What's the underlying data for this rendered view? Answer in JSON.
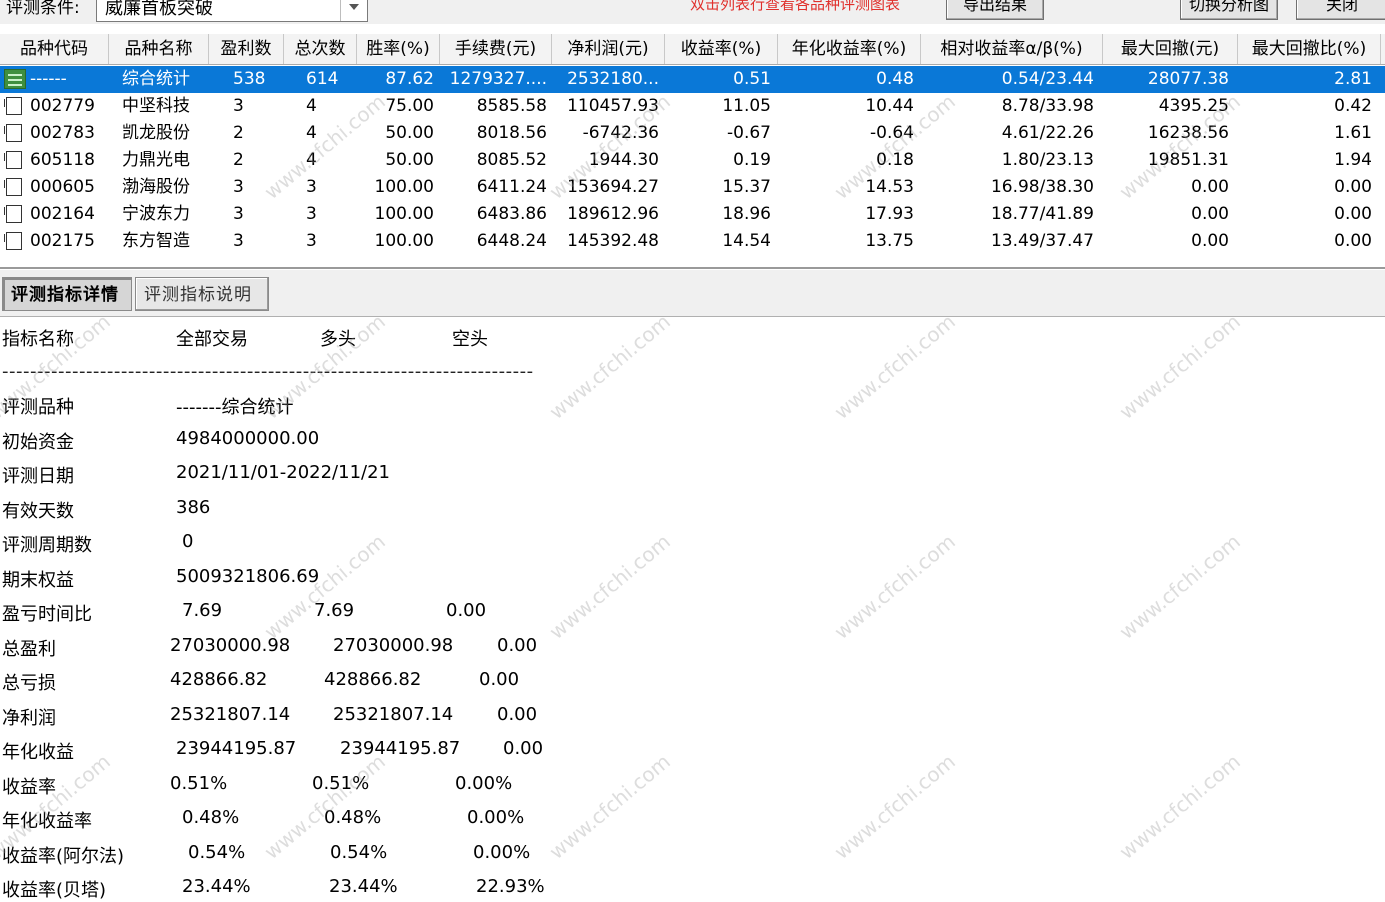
{
  "toolbar": {
    "condition_label": "评测条件:",
    "condition_value": "威廉首板突破",
    "hint": "双击列表行查看各品种评测图表",
    "export_button": "导出结果",
    "switch_button": "切换分析图",
    "close_button": "关闭"
  },
  "table": {
    "headers": [
      "品种代码",
      "品种名称",
      "盈利数",
      "总次数",
      "胜率(%)",
      "手续费(元)",
      "净利润(元)",
      "收益率(%)",
      "年化收益率(%)",
      "相对收益率α/β(%)",
      "最大回撤(元)",
      "最大回撤比(%)"
    ],
    "rows": [
      [
        "------",
        "综合统计",
        "538",
        "614",
        "87.62",
        "1279327....",
        "2532180...",
        "0.51",
        "0.48",
        "0.54/23.44",
        "28077.38",
        "2.81"
      ],
      [
        "002779",
        "中坚科技",
        "3",
        "4",
        "75.00",
        "8585.58",
        "110457.93",
        "11.05",
        "10.44",
        "8.78/33.98",
        "4395.25",
        "0.42"
      ],
      [
        "002783",
        "凯龙股份",
        "2",
        "4",
        "50.00",
        "8018.56",
        "-6742.36",
        "-0.67",
        "-0.64",
        "4.61/22.26",
        "16238.56",
        "1.61"
      ],
      [
        "605118",
        "力鼎光电",
        "2",
        "4",
        "50.00",
        "8085.52",
        "1944.30",
        "0.19",
        "0.18",
        "1.80/23.13",
        "19851.31",
        "1.94"
      ],
      [
        "000605",
        "渤海股份",
        "3",
        "3",
        "100.00",
        "6411.24",
        "153694.27",
        "15.37",
        "14.53",
        "16.98/38.30",
        "0.00",
        "0.00"
      ],
      [
        "002164",
        "宁波东力",
        "3",
        "3",
        "100.00",
        "6483.86",
        "189612.96",
        "18.96",
        "17.93",
        "18.77/41.89",
        "0.00",
        "0.00"
      ],
      [
        "002175",
        "东方智造",
        "3",
        "3",
        "100.00",
        "6448.24",
        "145392.48",
        "14.54",
        "13.75",
        "13.49/37.47",
        "0.00",
        "0.00"
      ]
    ]
  },
  "tabs": [
    "评测指标详情",
    "评测指标说明"
  ],
  "detail": {
    "header": [
      "指标名称",
      "全部交易",
      "多头",
      "空头"
    ],
    "divider": "----------------------------------------------------------------------------",
    "rows": [
      [
        "评测品种",
        "-------综合统计",
        "",
        ""
      ],
      [
        "初始资金",
        "4984000000.00",
        "",
        ""
      ],
      [
        "评测日期",
        "2021/11/01-2022/11/21",
        "",
        ""
      ],
      [
        "有效天数",
        "386",
        "",
        ""
      ],
      [
        "评测周期数",
        "0",
        "",
        ""
      ],
      [
        "期末权益",
        "5009321806.69",
        "",
        ""
      ],
      [
        "盈亏时间比",
        "7.69",
        "7.69",
        "0.00"
      ],
      [
        "总盈利",
        "27030000.98",
        "27030000.98",
        "0.00"
      ],
      [
        "总亏损",
        "428866.82",
        "428866.82",
        "0.00"
      ],
      [
        "净利润",
        "25321807.14",
        "25321807.14",
        "0.00"
      ],
      [
        "年化收益",
        "23944195.87",
        "23944195.87",
        "0.00"
      ],
      [
        "收益率",
        "0.51%",
        "0.51%",
        "0.00%"
      ],
      [
        "年化收益率",
        "0.48%",
        "0.48%",
        "0.00%"
      ],
      [
        "收益率(阿尔法)",
        "0.54%",
        "0.54%",
        "0.00%"
      ],
      [
        "收益率(贝塔)",
        "23.44%",
        "23.44%",
        "22.93%"
      ]
    ]
  },
  "watermark": "www.cfchi.com",
  "colors": {
    "selection": "#0a78d7",
    "hint": "#e0302c"
  }
}
